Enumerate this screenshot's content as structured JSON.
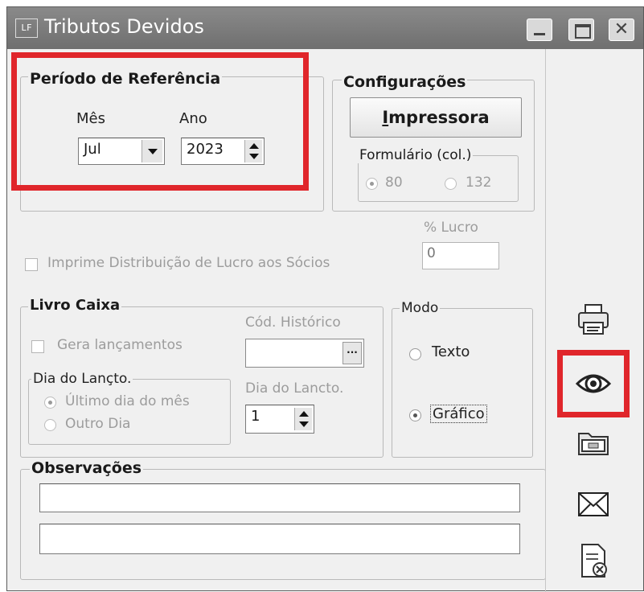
{
  "window": {
    "title": "Tributos Devidos",
    "app_icon_text": "LF"
  },
  "periodo": {
    "legend": "Período de Referência",
    "mes_label": "Mês",
    "mes_value": "Jul",
    "ano_label": "Ano",
    "ano_value": "2023"
  },
  "configuracoes": {
    "legend": "Configurações",
    "impressora_button": "Impressora",
    "formulario_legend": "Formulário (col.)",
    "option_80": "80",
    "option_132": "132",
    "selected": "80"
  },
  "lucro": {
    "label": "% Lucro",
    "value": "0"
  },
  "distribuicao_checkbox": "Imprime Distribuição de Lucro aos Sócios",
  "livro_caixa": {
    "legend": "Livro Caixa",
    "gera_lancamentos": "Gera lançamentos",
    "cod_historico_label": "Cód. Histórico",
    "browse_button": "...",
    "dia_legend": "Dia do Lançto.",
    "ultimo_dia": "Último dia do mês",
    "outro_dia": "Outro Dia",
    "dia_label": "Dia do Lancto.",
    "dia_value": "1"
  },
  "modo": {
    "legend": "Modo",
    "texto": "Texto",
    "grafico": "Gráfico",
    "selected": "Gráfico"
  },
  "observacoes": {
    "legend": "Observações",
    "line1": "",
    "line2": ""
  },
  "side_icons": [
    "printer-icon",
    "eye-icon",
    "folder-icon",
    "envelope-icon",
    "document-close-icon"
  ],
  "colors": {
    "highlight": "#e0262b",
    "titlebar": "#7a7a7a",
    "window_bg": "#f0f0f0"
  }
}
